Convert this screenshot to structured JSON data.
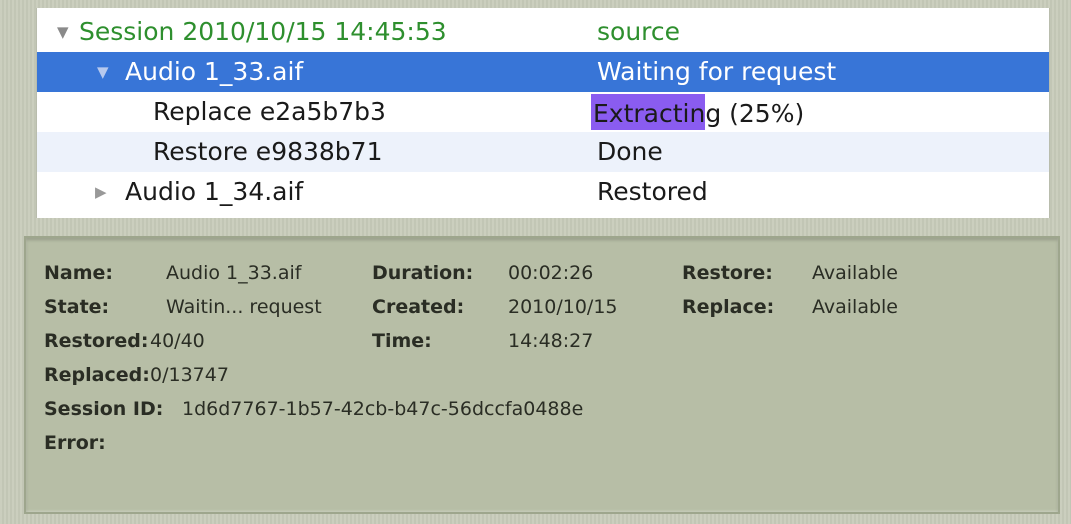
{
  "tree": {
    "session": {
      "name": "Session 2010/10/15 14:45:53",
      "status": "source",
      "expanded_icon": "triangle-down-icon"
    },
    "rows": [
      {
        "name": "Audio 1_33.aif",
        "status": "Waiting for request",
        "selected": true,
        "expander": "triangle-down-icon"
      },
      {
        "name": "Replace e2a5b7b3",
        "status": "Extracting (25%)",
        "progress": 0.25
      },
      {
        "name": "Restore e9838b71",
        "status": "Done"
      },
      {
        "name": "Audio 1_34.aif",
        "status": "Restored",
        "expander": "triangle-right-icon"
      }
    ]
  },
  "details": {
    "name_label": "Name:",
    "name_value": "Audio 1_33.aif",
    "state_label": "State:",
    "state_value": "Waitin... request",
    "restored_label": "Restored:",
    "restored_value": "40/40",
    "replaced_label": "Replaced:",
    "replaced_value": "0/13747",
    "session_id_label": "Session ID:",
    "session_id_value": "1d6d7767-1b57-42cb-b47c-56dccfa0488e",
    "error_label": "Error:",
    "error_value": "",
    "duration_label": "Duration:",
    "duration_value": "00:02:26",
    "created_label": "Created:",
    "created_value": "2010/10/15",
    "time_label": "Time:",
    "time_value": "14:48:27",
    "restore_label": "Restore:",
    "restore_value": "Available",
    "replace_label": "Replace:",
    "replace_value": "Available"
  },
  "colors": {
    "selection": "#3875d7",
    "session_text": "#2e8f2e",
    "progress_fill": "#8a5cf0",
    "panel_bg": "#b7bea6"
  }
}
